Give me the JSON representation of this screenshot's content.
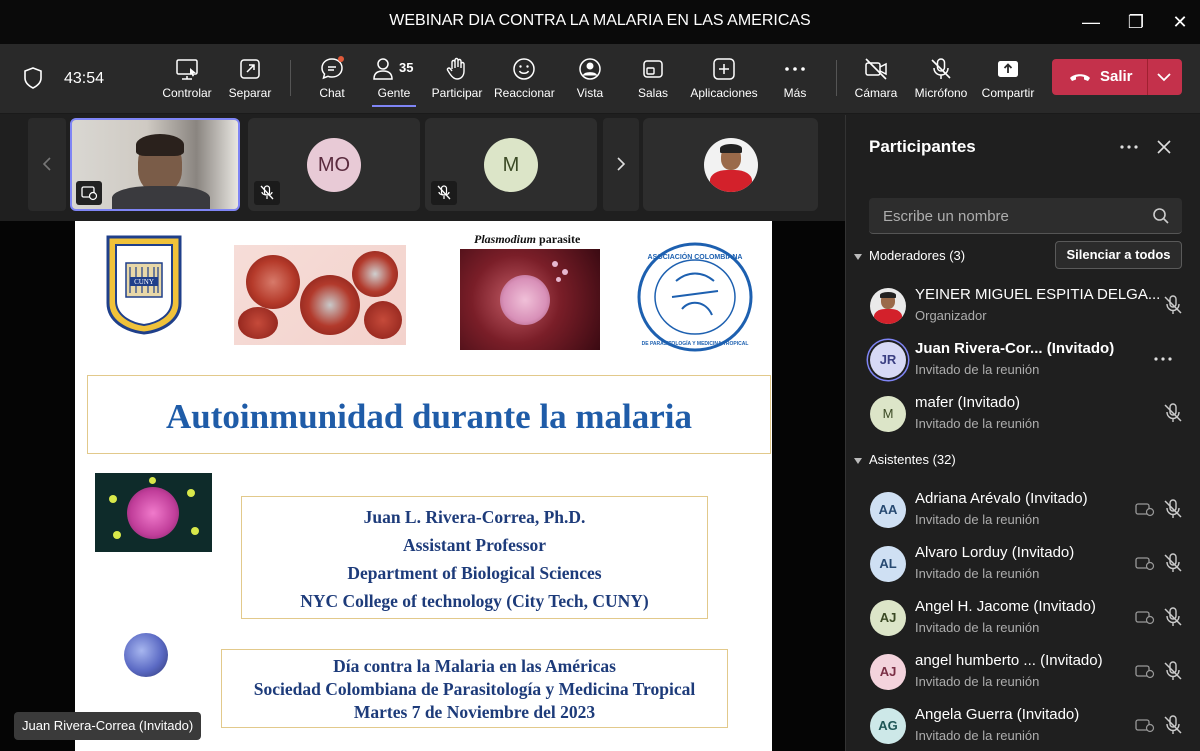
{
  "window": {
    "title": "WEBINAR DIA CONTRA LA MALARIA EN LAS AMERICAS",
    "minimize": "—",
    "restore": "❐",
    "close": "✕"
  },
  "toolbar": {
    "timer": "43:54",
    "controlar": "Controlar",
    "separar": "Separar",
    "chat": "Chat",
    "people_count": "35",
    "gente": "Gente",
    "participar": "Participar",
    "reaccionar": "Reaccionar",
    "vista": "Vista",
    "salas": "Salas",
    "aplicaciones": "Aplicaciones",
    "mas": "Más",
    "camara": "Cámara",
    "microfono": "Micrófono",
    "compartir": "Compartir",
    "salir": "Salir"
  },
  "gallery": {
    "tiles": [
      {
        "initials": "MO"
      },
      {
        "initials": "M"
      }
    ]
  },
  "slide": {
    "logo_nyc": "NEW YORK CITY COLLEGE OF TECHNOLOGY",
    "logo_cuny": "CUNY",
    "plasmodium_caption_italic": "Plasmodium",
    "plasmodium_caption_rest": " parasite",
    "logo_assoc_top": "ASOCIACIÓN COLOMBIANA",
    "logo_assoc_bottom": "DE PARASITOLOGÍA Y MEDICINA TROPICAL",
    "title": "Autoinmunidad durante la malaria",
    "author_lines": [
      "Juan L. Rivera-Correa, Ph.D.",
      "Assistant Professor",
      "Department of Biological Sciences",
      "NYC College of technology (City Tech, CUNY)"
    ],
    "event_lines": [
      "Día contra la Malaria en las Américas",
      "Sociedad Colombiana de Parasitología y Medicina Tropical",
      "Martes 7 de Noviembre del 2023"
    ]
  },
  "speaker_chip": "Juan Rivera-Correa (Invitado)",
  "panel": {
    "title": "Participantes",
    "search_placeholder": "Escribe un nombre",
    "moderators_label": "Moderadores (3)",
    "silence_all": "Silenciar a todos",
    "attendees_label": "Asistentes (32)",
    "moderators": [
      {
        "initials": "",
        "name": "YEINER MIGUEL ESPITIA DELGA...",
        "sub": "Organizador"
      },
      {
        "initials": "JR",
        "name": "Juan Rivera-Cor...  (Invitado)",
        "sub": "Invitado de la reunión"
      },
      {
        "initials": "M",
        "name": "mafer (Invitado)",
        "sub": "Invitado de la reunión"
      }
    ],
    "attendees": [
      {
        "initials": "AA",
        "name": "Adriana Arévalo (Invitado)",
        "sub": "Invitado de la reunión"
      },
      {
        "initials": "AL",
        "name": "Alvaro Lorduy (Invitado)",
        "sub": "Invitado de la reunión"
      },
      {
        "initials": "AJ",
        "name": "Angel H. Jacome (Invitado)",
        "sub": "Invitado de la reunión"
      },
      {
        "initials": "AJ",
        "name": "angel humberto ... (Invitado)",
        "sub": "Invitado de la reunión"
      },
      {
        "initials": "AG",
        "name": "Angela Guerra (Invitado)",
        "sub": "Invitado de la reunión"
      }
    ]
  },
  "colors": {
    "accent": "#7f85f5",
    "leave": "#c4314b",
    "slide_blue": "#1f5ca8",
    "slide_navy": "#1d3b7a"
  }
}
